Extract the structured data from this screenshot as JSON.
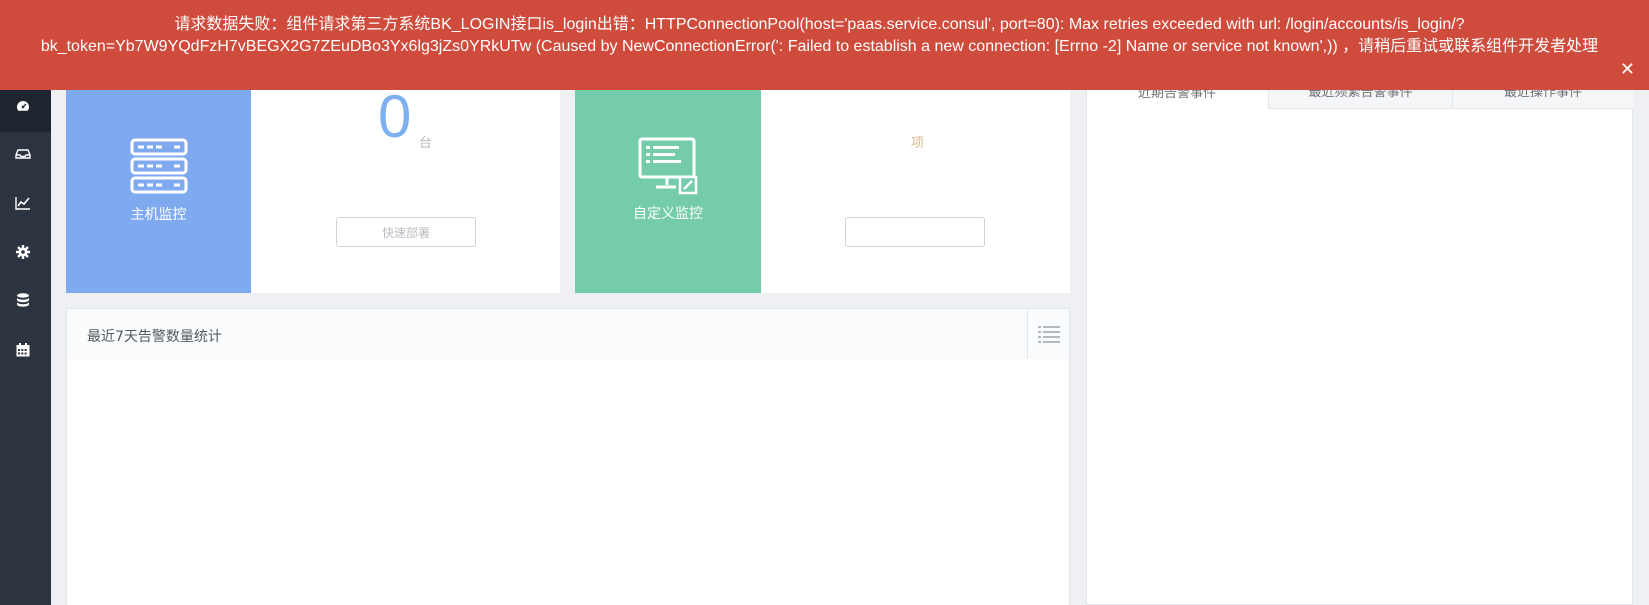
{
  "banner": {
    "message": "请求数据失败：组件请求第三方系统BK_LOGIN接口is_login出错：HTTPConnectionPool(host='paas.service.consul', port=80): Max retries exceeded with url: /login/accounts/is_login/?bk_token=Yb7W9YQdFzH7vBEGX2G7ZEuDBo3Yx6lg3jZs0YRkUTw (Caused by NewConnectionError(': Failed to establish a new connection: [Errno -2] Name or service not known',)) ，请稍后重试或联系组件开发者处理",
    "close_glyph": "✕",
    "color": "#cf4b3c"
  },
  "sidebar": {
    "items": [
      {
        "icon": "dashboard-icon"
      },
      {
        "icon": "inbox-icon"
      },
      {
        "icon": "line-chart-icon"
      },
      {
        "icon": "gear-icon"
      },
      {
        "icon": "database-icon"
      },
      {
        "icon": "calendar-icon"
      }
    ]
  },
  "host_monitor": {
    "label": "主机监控",
    "count": "0",
    "unit": "台",
    "button": "快速部署",
    "color": "#7faaf0"
  },
  "custom_monitor": {
    "label": "自定义监控",
    "count": "",
    "unit": "项",
    "button": "",
    "color": "#74ccab"
  },
  "alert_stats": {
    "title": "最近7天告警数量统计"
  },
  "events": {
    "tabs": [
      "近期告警事件",
      "最近频繁告警事件",
      "最近操作事件"
    ]
  }
}
